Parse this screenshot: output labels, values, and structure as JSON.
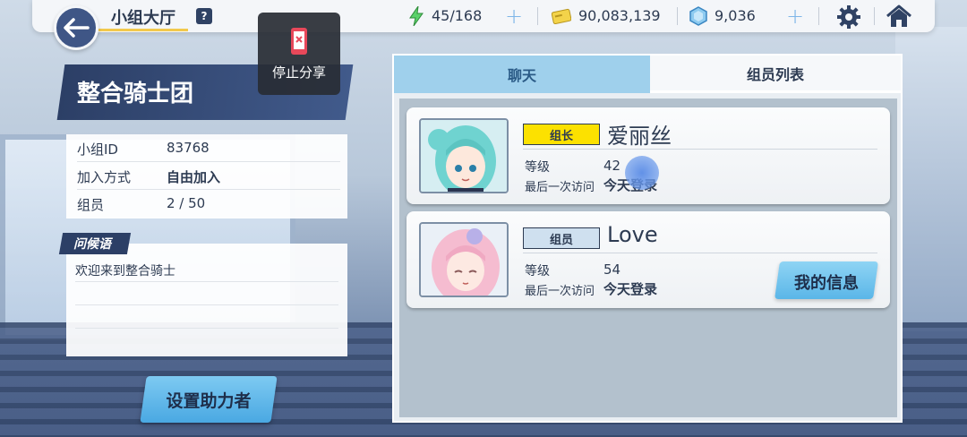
{
  "header": {
    "title": "小组大厅",
    "help": "?",
    "stamina": "45/168",
    "credits": "90,083,139",
    "gems": "9,036"
  },
  "share_overlay": {
    "label": "停止分享"
  },
  "guild": {
    "name": "整合骑士团",
    "info": [
      {
        "key": "小组ID",
        "value": "83768"
      },
      {
        "key": "加入方式",
        "value": "自由加入"
      },
      {
        "key": "组员",
        "value": "2 / 50"
      }
    ],
    "greeting_label": "问候语",
    "greeting_text": "欢迎来到整合骑士",
    "assist_button": "设置助力者"
  },
  "tabs": {
    "chat": "聊天",
    "members": "组员列表"
  },
  "members": [
    {
      "role": "组长",
      "name": "爱丽丝",
      "level_label": "等级",
      "level": "42",
      "last_label": "最后一次访问",
      "last": "今天登录",
      "role_color": "#fce100"
    },
    {
      "role": "组员",
      "name": "Love",
      "level_label": "等级",
      "level": "54",
      "last_label": "最后一次访问",
      "last": "今天登录",
      "role_color": "#cfe0ef"
    }
  ],
  "my_info_button": "我的信息"
}
